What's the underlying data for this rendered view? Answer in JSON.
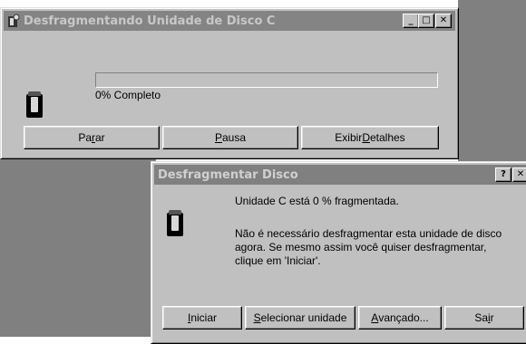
{
  "defrag_window": {
    "title": "Desfragmentando Unidade de Disco C",
    "status": "0% Completo",
    "progress": 0,
    "buttons": {
      "stop": {
        "pre": "Pa",
        "u": "r",
        "post": "ar"
      },
      "pause": {
        "pre": "",
        "u": "P",
        "post": "ausa"
      },
      "details": {
        "pre": "Exibir ",
        "u": "D",
        "post": "etalhes"
      }
    },
    "caption": {
      "minimize": "_",
      "maximize": "□",
      "close": "✕"
    }
  },
  "dialog": {
    "title": "Desfragmentar Disco",
    "line1": "Unidade C está 0 % fragmentada.",
    "line2": "Não é necessário desfragmentar esta unidade de disco agora. Se mesmo assim você quiser desfragmentar, clique em 'Iniciar'.",
    "caption": {
      "help": "?",
      "close": "✕"
    },
    "buttons": {
      "start": {
        "pre": "",
        "u": "I",
        "post": "niciar"
      },
      "select_drive": {
        "pre": "",
        "u": "S",
        "post": "elecionar unidade"
      },
      "advanced": {
        "pre": "",
        "u": "A",
        "post": "vançado..."
      },
      "exit": {
        "pre": "Sa",
        "u": "i",
        "post": "r"
      }
    }
  },
  "icons": {
    "title_icon": "defrag-icon",
    "disk_icon": "disk-icon"
  }
}
